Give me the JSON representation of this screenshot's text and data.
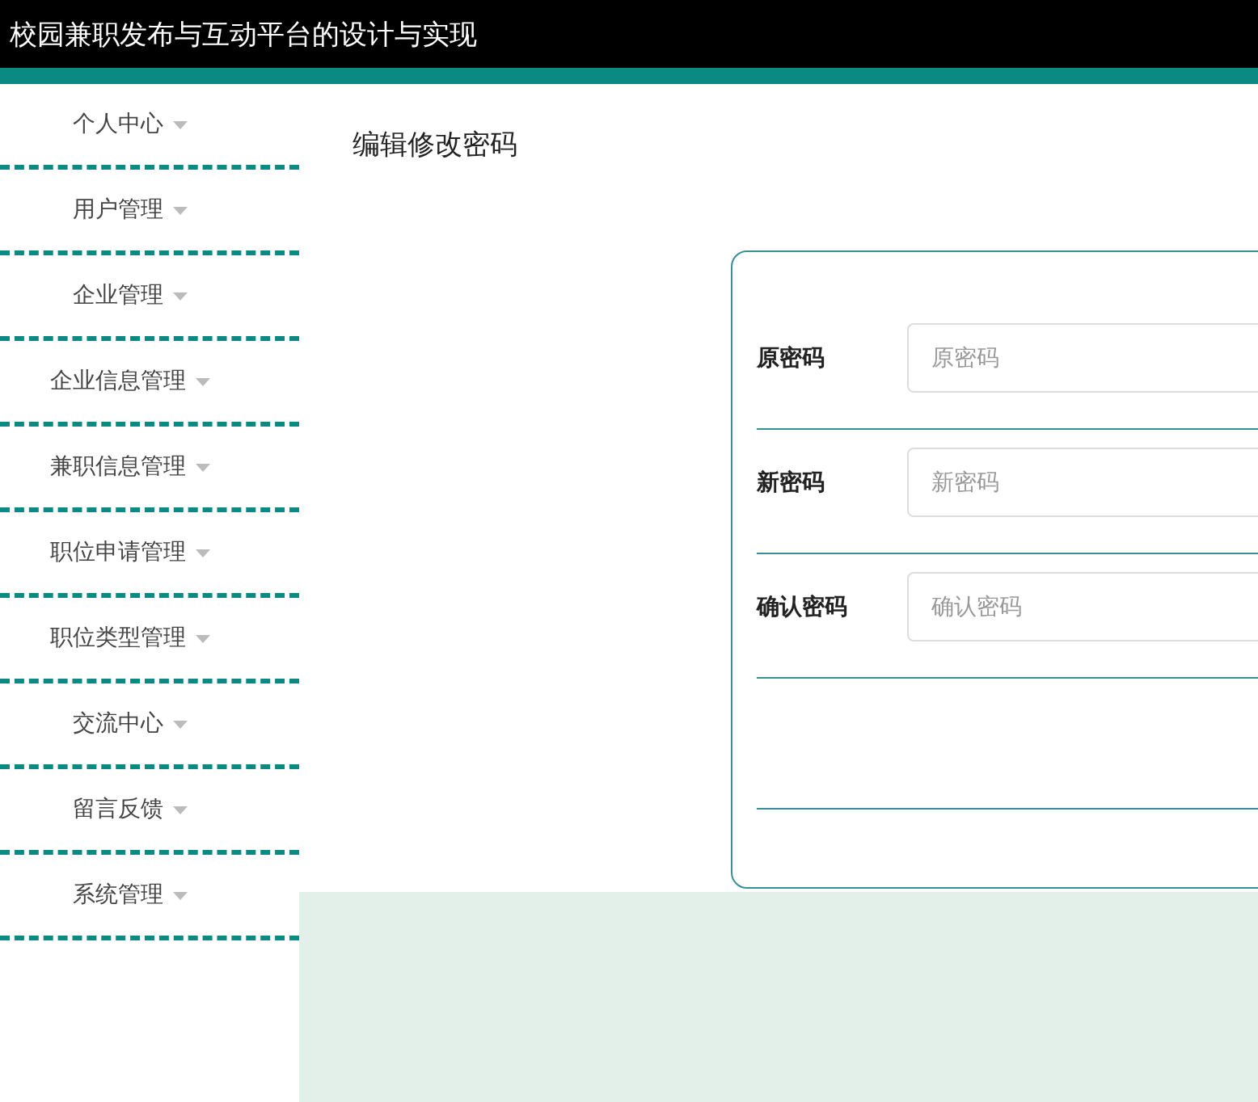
{
  "header": {
    "title": "校园兼职发布与互动平台的设计与实现"
  },
  "sidebar": {
    "items": [
      {
        "label": "个人中心"
      },
      {
        "label": "用户管理"
      },
      {
        "label": "企业管理"
      },
      {
        "label": "企业信息管理"
      },
      {
        "label": "兼职信息管理"
      },
      {
        "label": "职位申请管理"
      },
      {
        "label": "职位类型管理"
      },
      {
        "label": "交流中心"
      },
      {
        "label": "留言反馈"
      },
      {
        "label": "系统管理"
      }
    ]
  },
  "page": {
    "title": "编辑修改密码"
  },
  "form": {
    "fields": [
      {
        "label": "原密码",
        "placeholder": "原密码"
      },
      {
        "label": "新密码",
        "placeholder": "新密码"
      },
      {
        "label": "确认密码",
        "placeholder": "确认密码"
      }
    ]
  }
}
